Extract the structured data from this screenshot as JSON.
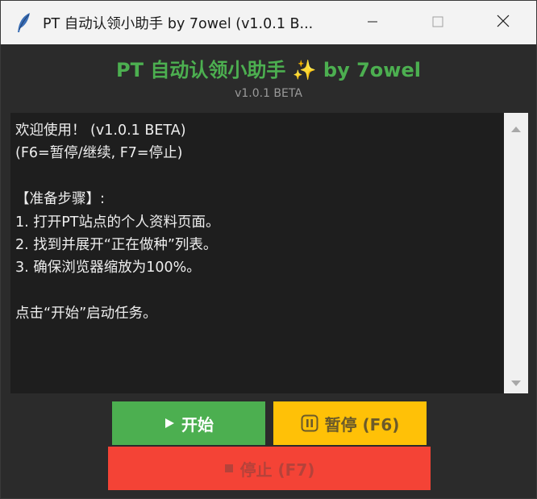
{
  "window": {
    "title": "PT 自动认领小助手 by 7owel (v1.0.1 B...",
    "icon": "feather-icon"
  },
  "header": {
    "title": "PT 自动认领小助手 ✨ by 7owel",
    "version": "v1.0.1 BETA"
  },
  "log": {
    "lines": [
      "欢迎使用！ (v1.0.1 BETA)",
      "(F6=暂停/继续, F7=停止)",
      "",
      "【准备步骤】:",
      "1. 打开PT站点的个人资料页面。",
      "2. 找到并展开“正在做种”列表。",
      "3. 确保浏览器缩放为100%。",
      "",
      "点击“开始”启动任务。"
    ]
  },
  "buttons": {
    "start_label": "开始",
    "pause_label": "暂停 (F6)",
    "stop_label": "停止 (F7)"
  },
  "colors": {
    "accent": "#4caf50",
    "start": "#4caf50",
    "pause": "#ffc107",
    "stop": "#f44336",
    "background": "#2b2b2b"
  }
}
